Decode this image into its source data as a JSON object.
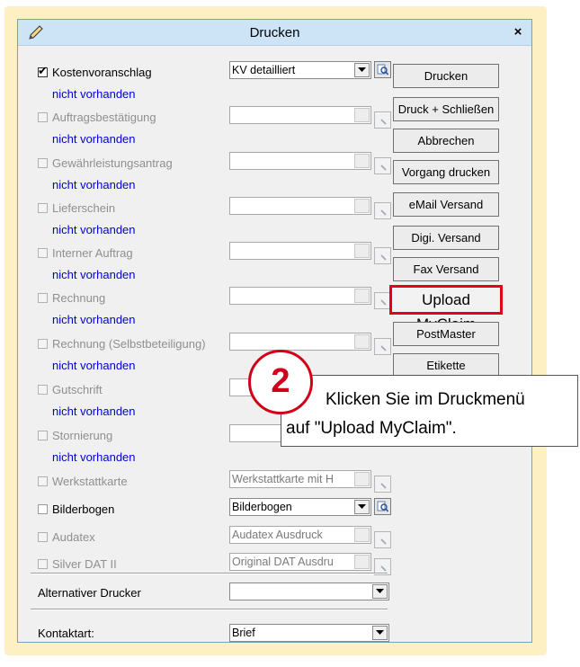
{
  "window": {
    "title": "Drucken",
    "close_label": "×"
  },
  "documents": [
    {
      "label": "Kostenvoranschlag",
      "checked": true,
      "enabled": true,
      "status": "nicht vorhanden",
      "select_value": "KV detailliert"
    },
    {
      "label": "Auftragsbestätigung",
      "checked": false,
      "enabled": false,
      "status": "nicht vorhanden",
      "select_value": ""
    },
    {
      "label": "Gewährleistungsantrag",
      "checked": false,
      "enabled": false,
      "status": "nicht vorhanden",
      "select_value": ""
    },
    {
      "label": "Lieferschein",
      "checked": false,
      "enabled": false,
      "status": "nicht vorhanden",
      "select_value": ""
    },
    {
      "label": "Interner Auftrag",
      "checked": false,
      "enabled": false,
      "status": "nicht vorhanden",
      "select_value": ""
    },
    {
      "label": "Rechnung",
      "checked": false,
      "enabled": false,
      "status": "nicht vorhanden",
      "select_value": ""
    },
    {
      "label": "Rechnung (Selbstbeteiligung)",
      "checked": false,
      "enabled": false,
      "status": "nicht vorhanden",
      "select_value": ""
    },
    {
      "label": "Gutschrift",
      "checked": false,
      "enabled": false,
      "status": "nicht vorhanden",
      "select_value": ""
    },
    {
      "label": "Stornierung",
      "checked": false,
      "enabled": false,
      "status": "nicht vorhanden",
      "select_value": ""
    },
    {
      "label": "Werkstattkarte",
      "checked": false,
      "enabled": false,
      "select_value": "Werkstattkarte mit H"
    },
    {
      "label": "Bilderbogen",
      "checked": false,
      "enabled": true,
      "select_value": "Bilderbogen"
    },
    {
      "label": "Audatex",
      "checked": false,
      "enabled": false,
      "select_value": "Audatex Ausdruck"
    },
    {
      "label": "Silver DAT II",
      "checked": false,
      "enabled": false,
      "select_value": "Original DAT Ausdru"
    }
  ],
  "buttons": [
    {
      "label": "Drucken"
    },
    {
      "label": "Druck + Schließen"
    },
    {
      "label": "Abbrechen"
    },
    {
      "label": "Vorgang drucken"
    },
    {
      "label": "eMail Versand"
    },
    {
      "label": "Digi. Versand"
    },
    {
      "label": "Fax Versand"
    },
    {
      "label": "Upload MyClaim"
    },
    {
      "label": "PostMaster"
    },
    {
      "label": "Etikette"
    }
  ],
  "printer": {
    "label": "Alternativer Drucker",
    "value": ""
  },
  "contact": {
    "label": "Kontaktart:",
    "value": "Brief"
  },
  "callout": {
    "step": "2",
    "line1": "Klicken Sie im Druckmenü",
    "line2": "auf \"Upload MyClaim\"."
  },
  "colors": {
    "highlight": "#e2001a",
    "status_text": "#0000d6",
    "titlebar": "#cde4f7",
    "backdrop": "#fdf0c2"
  }
}
